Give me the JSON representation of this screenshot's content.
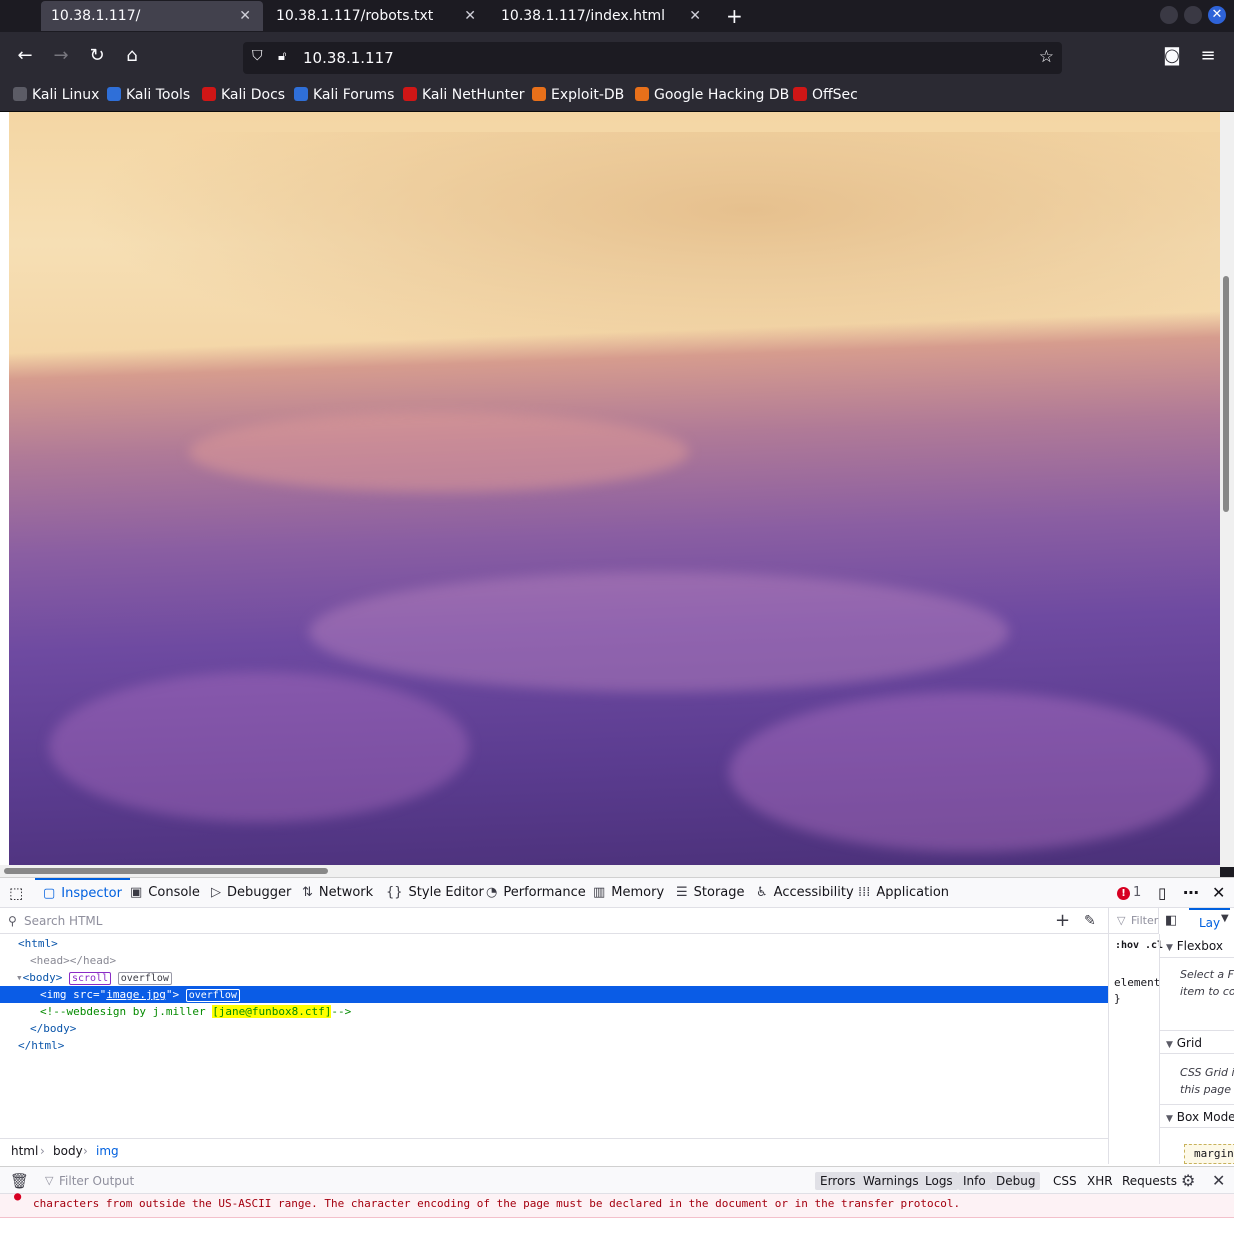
{
  "browser": {
    "tabs": [
      {
        "title": "10.38.1.117/",
        "active": true
      },
      {
        "title": "10.38.1.117/robots.txt",
        "active": false
      },
      {
        "title": "10.38.1.117/index.html",
        "active": false
      }
    ],
    "url": "10.38.1.117",
    "bookmarks": [
      {
        "label": "Kali Linux",
        "color": "#5c5c66"
      },
      {
        "label": "Kali Tools",
        "color": "#2f6fd8"
      },
      {
        "label": "Kali Docs",
        "color": "#d01616"
      },
      {
        "label": "Kali Forums",
        "color": "#2f6fd8"
      },
      {
        "label": "Kali NetHunter",
        "color": "#d01616"
      },
      {
        "label": "Exploit-DB",
        "color": "#e8701a"
      },
      {
        "label": "Google Hacking DB",
        "color": "#e8701a"
      },
      {
        "label": "OffSec",
        "color": "#d01616"
      }
    ]
  },
  "devtools": {
    "tabs": [
      "Inspector",
      "Console",
      "Debugger",
      "Network",
      "Style Editor",
      "Performance",
      "Memory",
      "Storage",
      "Accessibility",
      "Application"
    ],
    "error_count": "1",
    "search_placeholder": "Search HTML",
    "markup": {
      "html_open": "<html>",
      "head": "<head></head>",
      "body_open": "<body>",
      "body_badges": [
        "scroll",
        "overflow"
      ],
      "img_tag_start": "<img src=\"",
      "img_src": "image.jpg",
      "img_tag_end": "\">",
      "img_badge": "overflow",
      "comment_start": "<!--webdesign by j.miller ",
      "comment_email": "[jane@funbox8.ctf]",
      "comment_end": "-->",
      "body_close": "</body>",
      "html_close": "</html>"
    },
    "breadcrumbs": [
      "html",
      "body",
      "img"
    ],
    "sidebar": {
      "filter": "Filter",
      "hov": ":hov",
      "cls": ".cl",
      "layout_tab": "Lay",
      "element_rule": "element",
      "brace": "}",
      "flexbox": "Flexbox",
      "flexbox_text": "Select a F item to co",
      "grid": "Grid",
      "grid_text": "CSS Grid i this page",
      "box_model": "Box Mode",
      "margin": "margin"
    },
    "console": {
      "filter_placeholder": "Filter Output",
      "levels": [
        "Errors",
        "Warnings",
        "Logs",
        "Info",
        "Debug"
      ],
      "extra": [
        "CSS",
        "XHR",
        "Requests"
      ],
      "message": "characters from outside the US-ASCII range. The character encoding of the page must be declared in the document or in the transfer protocol."
    }
  }
}
